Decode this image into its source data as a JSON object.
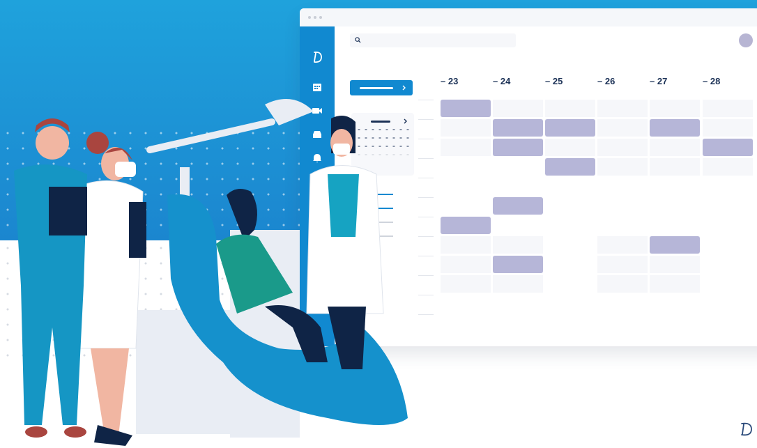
{
  "calendar": {
    "days": [
      "– 23",
      "– 24",
      "– 25",
      "– 26",
      "– 27",
      "– 28"
    ]
  },
  "colors": {
    "primary": "#1189d0",
    "background_blue": "#1b8fd4",
    "appointment": "#b6b6d8",
    "text_dark": "#1b3156"
  }
}
